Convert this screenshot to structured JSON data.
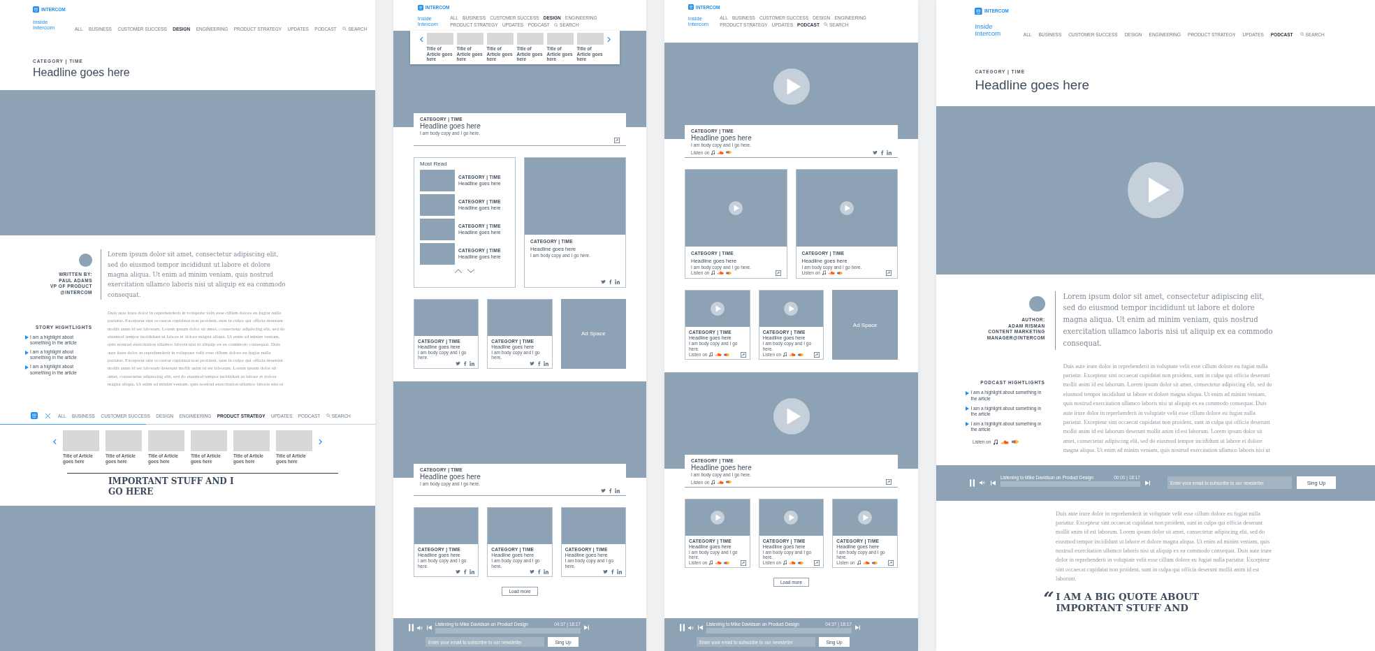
{
  "panels": [
    {
      "header": {
        "logo": "INTERCOM",
        "brand": "Inside Intercom",
        "search": "SEARCH",
        "nav": [
          {
            "label": "ALL",
            "selected": false
          },
          {
            "label": "BUSINESS",
            "selected": false
          },
          {
            "label": "CUSTOMER SUCCESS",
            "selected": false
          },
          {
            "label": "DESIGN",
            "selected": true
          },
          {
            "label": "ENGINEERING",
            "selected": false
          },
          {
            "label": "PRODUCT STRATEGY",
            "selected": false
          },
          {
            "label": "UPDATES",
            "selected": false
          },
          {
            "label": "PODCAST",
            "selected": false
          }
        ]
      },
      "blocks": [
        {
          "kind": "title",
          "category": "CATEGORY | TIME",
          "headline": "Headline goes here"
        },
        {
          "kind": "hero",
          "play": false
        },
        {
          "kind": "article",
          "author": [
            "WRITTEN BY:",
            "PAUL ADAMS",
            "VP OF PRODUCT",
            "@INTERCOM"
          ],
          "lead": "Lorem ipsum dolor sit amet, consectetur adipiscing elit, sed do eiusmod tempor incididunt ut labore et dolore magna aliqua. Ut enim ad minim veniam, quis nostrud exercitation ullamco laboris nisi ut aliquip ex ea commodo consequat.",
          "body": "Duis aute irure dolor in reprehenderit in voluptate velit esse cillum dolore eu fugiat nulla pariatur. Excepteur sint occaecat cupidatat non proident, sunt in culpa qui officia deserunt mollit anim id est laborum. Lorem ipsum dolor sit amet, consectetur adipiscing elit, sed do eiusmod tempor incididunt ut labore et dolore magna aliqua. Ut enim ad minim veniam, quis nostrud exercitation ullamco laboris nisi ut aliquip ex ea commodo consequat. Duis aute irure dolor in reprehenderit in voluptate velit esse cillum dolore eu fugiat nulla pariatur. Excepteur sint occaecat cupidatat non proident, sunt in culpa qui officia deserunt mollit anim id est laborum deserunt mollit anim id est laborum. Lorem ipsum dolor sit amet, consectetur adipiscing elit, sed do eiusmod tempor incididunt ut labore et dolore magna aliqua. Ut enim ad minim veniam, quis nostrud exercitation ullamco laboris nisi ut",
          "highlights_title": "STORY HIGHTLIGHTS",
          "highlights": [
            "I am a highlight about something in the article",
            "I am a highlight about something in the article",
            "I am a highlight about something in the article"
          ]
        },
        {
          "kind": "sticky_nav",
          "search": "SEARCH",
          "level": 0.39,
          "nav": [
            {
              "label": "ALL",
              "selected": false
            },
            {
              "label": "BUSINESS",
              "selected": false
            },
            {
              "label": "CUSTOMER SUCCESS",
              "selected": false
            },
            {
              "label": "DESIGN",
              "selected": false
            },
            {
              "label": "ENGINEERING",
              "selected": false
            },
            {
              "label": "PRODUCT STRATEGY",
              "selected": true
            },
            {
              "label": "UPDATES",
              "selected": false
            },
            {
              "label": "PODCAST",
              "selected": false
            }
          ]
        },
        {
          "kind": "carousel",
          "items": [
            "Title of Article goes here",
            "Title of Article goes here",
            "Title of Article goes here",
            "Title of Article goes here",
            "Title of Article goes here",
            "Title of Article goes here"
          ]
        },
        {
          "kind": "quote",
          "rule": true,
          "text": "IMPORTANT STUFF AND I GO HERE"
        },
        {
          "kind": "hero",
          "play": false
        }
      ]
    },
    {
      "header": {
        "logo": "INTERCOM",
        "brand": "Inside Intercom",
        "search": "SEARCH",
        "nav": [
          {
            "label": "ALL",
            "selected": false
          },
          {
            "label": "BUSINESS",
            "selected": false
          },
          {
            "label": "CUSTOMER SUCCESS",
            "selected": false
          },
          {
            "label": "DESIGN",
            "selected": true
          },
          {
            "label": "ENGINEERING",
            "selected": false
          },
          {
            "label": "PRODUCT STRATEGY",
            "selected": false
          },
          {
            "label": "UPDATES",
            "selected": false
          },
          {
            "label": "PODCAST",
            "selected": false
          }
        ]
      },
      "blocks": [
        {
          "kind": "feature",
          "play": false,
          "carousel": [
            "Title of Article goes here",
            "Title of Article goes here",
            "Title of Article goes here",
            "Title of Article goes here",
            "Title of Article goes here",
            "Title of Article goes here"
          ],
          "card": {
            "category": "CATEGORY | TIME",
            "headline": "Headline goes here",
            "body": "I am body copy and I go here.",
            "social": false,
            "share": true
          }
        },
        {
          "kind": "most_read",
          "title": "Most Read",
          "items": [
            {
              "category": "CATEGORY | TIME",
              "headline": "Headline goes here"
            },
            {
              "category": "CATEGORY | TIME",
              "headline": "Headline goes here"
            },
            {
              "category": "CATEGORY | TIME",
              "headline": "Headline goes here"
            },
            {
              "category": "CATEGORY | TIME",
              "headline": "Headline goes here"
            }
          ],
          "card": {
            "category": "CATEGORY | TIME",
            "headline": "Headline goes here",
            "body": "I am body copy and I go here.",
            "social": true,
            "share": false
          }
        },
        {
          "kind": "cards",
          "items": [
            {
              "kind": "card",
              "play": false,
              "category": "CATEGORY | TIME",
              "headline": "Headline goes here",
              "body": "I am body copy and I go here.",
              "social": true,
              "share": false
            },
            {
              "kind": "card",
              "play": false,
              "category": "CATEGORY | TIME",
              "headline": "Headline goes here",
              "body": "I am body copy and I go here.",
              "social": true,
              "share": false
            },
            {
              "kind": "ad",
              "label": "Ad Space"
            }
          ]
        },
        {
          "kind": "feature",
          "play": false,
          "card": {
            "category": "CATEGORY | TIME",
            "headline": "Headline goes here",
            "body": "I am body copy and I go here.",
            "social": true,
            "share": false
          }
        },
        {
          "kind": "cards",
          "items": [
            {
              "kind": "card",
              "play": false,
              "category": "CATEGORY | TIME",
              "headline": "Headline goes here",
              "body": "I am body copy and I go here.",
              "social": true,
              "share": false
            },
            {
              "kind": "card",
              "play": false,
              "category": "CATEGORY | TIME",
              "headline": "Headline goes here",
              "body": "I am body copy and I go here.",
              "social": true,
              "share": false
            },
            {
              "kind": "card",
              "play": false,
              "category": "CATEGORY | TIME",
              "headline": "Headline goes here",
              "body": "I am body copy and I go here.",
              "social": true,
              "share": false
            }
          ]
        },
        {
          "kind": "load_more",
          "label": "Load more"
        },
        {
          "kind": "player",
          "title": "Listening to Mike Davidson on Product Design",
          "time": "04:37 | 18:17",
          "placeholder": "Enter your email to subscribe to our newsletter",
          "button": "Sing Up"
        }
      ]
    },
    {
      "header": {
        "logo": "INTERCOM",
        "brand": "Inside Intercom",
        "search": "SEARCH",
        "nav": [
          {
            "label": "ALL",
            "selected": false
          },
          {
            "label": "BUSINESS",
            "selected": false
          },
          {
            "label": "CUSTOMER SUCCESS",
            "selected": false
          },
          {
            "label": "DESIGN",
            "selected": false
          },
          {
            "label": "ENGINEERING",
            "selected": false
          },
          {
            "label": "PRODUCT STRATEGY",
            "selected": false
          },
          {
            "label": "UPDATES",
            "selected": false
          },
          {
            "label": "PODCAST",
            "selected": true
          }
        ]
      },
      "blocks": [
        {
          "kind": "feature",
          "play": true,
          "card": {
            "category": "CATEGORY | TIME",
            "headline": "Headline goes here",
            "body": "I am body copy and I go here.",
            "listen": "Listen on",
            "social": true,
            "share": false
          }
        },
        {
          "kind": "cards",
          "items": [
            {
              "kind": "card",
              "play": true,
              "category": "CATEGORY | TIME",
              "headline": "Headline goes here",
              "body": "I am body copy and I go here.",
              "listen": "Listen on",
              "social": false,
              "share": true
            },
            {
              "kind": "card",
              "play": true,
              "category": "CATEGORY | TIME",
              "headline": "Headline goes here",
              "body": "I am body copy and I go here.",
              "listen": "Listen on",
              "social": false,
              "share": true
            }
          ]
        },
        {
          "kind": "cards",
          "items": [
            {
              "kind": "card",
              "play": true,
              "category": "CATEGORY | TIME",
              "headline": "Headline goes here",
              "body": "I am body copy and I go here.",
              "listen": "Listen on",
              "social": false,
              "share": true
            },
            {
              "kind": "card",
              "play": true,
              "category": "CATEGORY | TIME",
              "headline": "Headline goes here",
              "body": "I am body copy and I go here.",
              "listen": "Listen on",
              "social": false,
              "share": true
            },
            {
              "kind": "ad",
              "label": "Ad Space"
            }
          ]
        },
        {
          "kind": "feature",
          "play": true,
          "card": {
            "category": "CATEGORY | TIME",
            "headline": "Headline goes here",
            "body": "I am body copy and I go here.",
            "listen": "Listen on",
            "social": false,
            "share": true
          }
        },
        {
          "kind": "cards",
          "items": [
            {
              "kind": "card",
              "play": true,
              "category": "CATEGORY | TIME",
              "headline": "Headline goes here",
              "body": "I am body copy and I go here.",
              "listen": "Listen on",
              "social": false,
              "share": true
            },
            {
              "kind": "card",
              "play": true,
              "category": "CATEGORY | TIME",
              "headline": "Headline goes here",
              "body": "I am body copy and I go here.",
              "listen": "Listen on",
              "social": false,
              "share": true
            },
            {
              "kind": "card",
              "play": true,
              "category": "CATEGORY | TIME",
              "headline": "Headline goes here",
              "body": "I am body copy and I go here.",
              "listen": "Listen on",
              "social": false,
              "share": true
            }
          ]
        },
        {
          "kind": "load_more",
          "label": "Load more"
        },
        {
          "kind": "player",
          "title": "Listening to Mike Davidson on Product Design",
          "time": "04:37 | 18:17",
          "placeholder": "Enter your email to subscribe to our newsletter",
          "button": "Sing Up"
        }
      ]
    },
    {
      "header": {
        "logo": "INTERCOM",
        "brand": "Inside Intercom",
        "search": "SEARCH",
        "nav": [
          {
            "label": "ALL",
            "selected": false
          },
          {
            "label": "BUSINESS",
            "selected": false
          },
          {
            "label": "CUSTOMER SUCCESS",
            "selected": false
          },
          {
            "label": "DESIGN",
            "selected": false
          },
          {
            "label": "ENGINEERING",
            "selected": false
          },
          {
            "label": "PRODUCT STRATEGY",
            "selected": false
          },
          {
            "label": "UPDATES",
            "selected": false
          },
          {
            "label": "PODCAST",
            "selected": true
          }
        ]
      },
      "blocks": [
        {
          "kind": "title",
          "category": "CATEGORY | TIME",
          "headline": "Headline goes here"
        },
        {
          "kind": "hero",
          "play": true
        },
        {
          "kind": "article",
          "author": [
            "AUTHOR:",
            "ADAM RISMAN",
            "CONTENT MARKETING",
            "MANAGER@INTERCOM"
          ],
          "lead": "Lorem ipsum dolor sit amet, consectetur adipiscing elit, sed do eiusmod tempor incididunt ut labore et dolore magna aliqua. Ut enim ad minim veniam, quis nostrud exercitation ullamco laboris nisi ut aliquip ex ea commodo consequat.",
          "body": "Duis aute irure dolor in reprehenderit in voluptate velit esse cillum dolore eu fugiat nulla pariatur. Excepteur sint occaecat cupidatat non proident, sunt in culpa qui officia deserunt mollit anim id est laborum. Lorem ipsum dolor sit amet, consectetur adipiscing elit, sed do eiusmod tempor incididunt ut labore et dolore magna aliqua. Ut enim ad minim veniam, quis nostrud exercitation ullamco laboris nisi ut aliquip ex ea commodo consequat. Duis aute irure dolor in reprehenderit in voluptate velit esse cillum dolore eu fugiat nulla pariatur. Excepteur sint occaecat cupidatat non proident, sunt in culpa qui officia deserunt mollit anim id est laborum deserunt mollit anim id est laborum. Lorem ipsum dolor sit amet, consectetur adipiscing elit, sed do eiusmod tempor incididunt ut labore et dolore magna aliqua. Ut enim ad minim veniam, quis nostrud exercitation ullamco laboris nisi ut",
          "highlights_title": "PODCAST HIGHTLIGHTS",
          "highlights": [
            "I am a highlight about something in the article",
            "I am a highlight about something in the article",
            "I am a highlight about something in the article"
          ],
          "listen": "Listen on"
        },
        {
          "kind": "player",
          "title": "Listening to Mike Davidson on Product Design",
          "time": "00:00 | 18:17",
          "placeholder": "Enter your email to subscribe to our newsletter",
          "button": "Sing Up"
        },
        {
          "kind": "body",
          "text": "Duis aute irure dolor in reprehenderit in voluptate velit esse cillum dolore eu fugiat nulla pariatur. Excepteur sint occaecat cupidatat non proident, sunt in culpa qui officia deserunt mollit anim id est laborum. Lorem ipsum dolor sit amet, consectetur adipiscing elit, sed do eiusmod tempor incididunt ut labore et dolore magna aliqua. Ut enim ad minim veniam, quis nostrud exercitation ullamco laboris nisi ut aliquip ex ea commodo consequat. Duis aute irure dolor in reprehenderit in voluptate velit esse cillum dolore eu fugiat nulla pariatur. Excepteur sint occaecat cupidatat non proident, sunt in culpa qui officia deserunt mollit anim id est laborum."
        },
        {
          "kind": "quote",
          "mark": "“",
          "text": "I AM A BIG QUOTE ABOUT IMPORTANT STUFF AND"
        }
      ]
    }
  ]
}
